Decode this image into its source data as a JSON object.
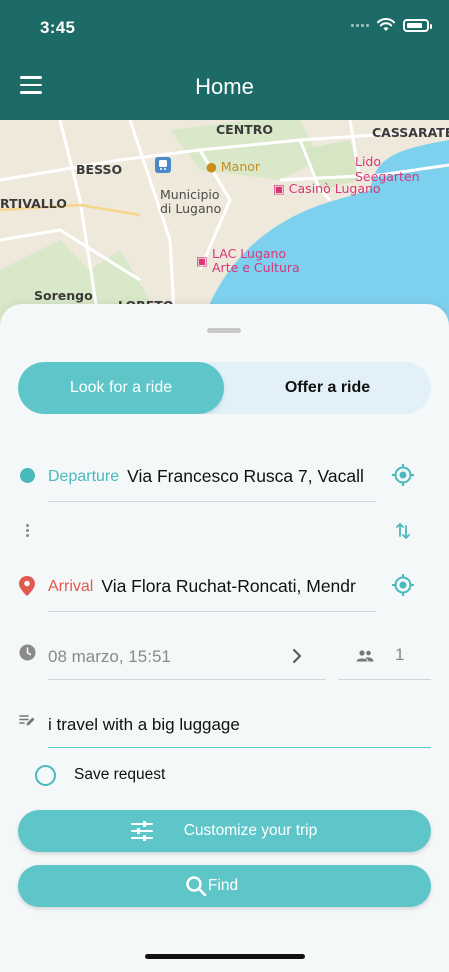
{
  "status_bar": {
    "time": "3:45"
  },
  "app_bar": {
    "title": "Home"
  },
  "map": {
    "labels": {
      "centro": "CENTRO",
      "cassarate": "CASSARATE",
      "besso": "BESSO",
      "manor": "Manor",
      "lido": "Lido Seegarten",
      "municipio": "Municipio\ndi Lugano",
      "casino": "Casinò Lugano",
      "trivallo": "RTIVALLO",
      "lac": "LAC Lugano\nArte e Cultura",
      "sorengo": "Sorengo",
      "loreto": "LORETO"
    }
  },
  "mode_toggle": {
    "active_label": "Look for a ride",
    "inactive_label": "Offer a ride"
  },
  "departure": {
    "label": "Departure",
    "value": "Via Francesco Rusca 7, Vacall"
  },
  "arrival": {
    "label": "Arrival",
    "value": "Via Flora Ruchat-Roncati, Mendr"
  },
  "datetime": {
    "value": "08 marzo, 15:51"
  },
  "seats": {
    "value": "1"
  },
  "note": {
    "value": "i travel with a big luggage"
  },
  "save_request": {
    "label": "Save request",
    "checked": false
  },
  "buttons": {
    "customize": "Customize your trip",
    "find": "Find"
  },
  "colors": {
    "app_bar": "#1d6b66",
    "accent": "#5ec5c8",
    "arrival": "#e15a4d"
  },
  "icons": {
    "menu": "hamburger-icon",
    "wifi": "wifi-icon",
    "battery": "battery-icon",
    "departure": "dot-icon",
    "arrival": "pin-icon",
    "locate": "gps-icon",
    "swap": "swap-icon",
    "clock": "clock-icon",
    "chevron": "chevron-right-icon",
    "people": "people-icon",
    "note": "edit-note-icon",
    "sliders": "sliders-icon",
    "search": "search-icon"
  }
}
